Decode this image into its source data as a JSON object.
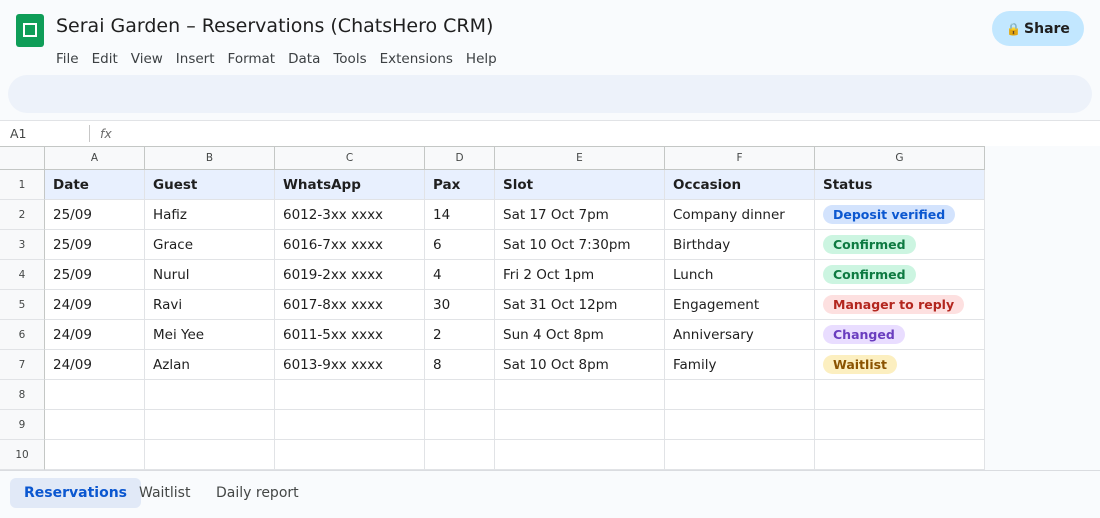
{
  "app": {
    "title": "Serai Garden – Reservations (ChatsHero CRM)",
    "share_label": "Share",
    "share_icon": "lock-icon"
  },
  "menu": [
    "File",
    "Edit",
    "View",
    "Insert",
    "Format",
    "Data",
    "Tools",
    "Extensions",
    "Help"
  ],
  "formula_bar": {
    "name_box": "A1",
    "fx_label": "fx",
    "value": ""
  },
  "sheet": {
    "columns": [
      "A",
      "B",
      "C",
      "D",
      "E",
      "F",
      "G"
    ],
    "row_numbers": [
      "1",
      "2",
      "3",
      "4",
      "5",
      "6",
      "7",
      "8",
      "9",
      "10"
    ],
    "headers": [
      "Date",
      "Guest",
      "WhatsApp",
      "Pax",
      "Slot",
      "Occasion",
      "Status"
    ],
    "rows": [
      {
        "date": "25/09",
        "guest": "Hafiz",
        "whatsapp": "6012-3xx xxxx",
        "pax": "14",
        "slot": "Sat 17 Oct 7pm",
        "occasion": "Company dinner",
        "status": "Deposit verified",
        "status_color": "blue"
      },
      {
        "date": "25/09",
        "guest": "Grace",
        "whatsapp": "6016-7xx xxxx",
        "pax": "6",
        "slot": "Sat 10 Oct 7:30pm",
        "occasion": "Birthday",
        "status": "Confirmed",
        "status_color": "green"
      },
      {
        "date": "25/09",
        "guest": "Nurul",
        "whatsapp": "6019-2xx xxxx",
        "pax": "4",
        "slot": "Fri 2 Oct 1pm",
        "occasion": "Lunch",
        "status": "Confirmed",
        "status_color": "green"
      },
      {
        "date": "24/09",
        "guest": "Ravi",
        "whatsapp": "6017-8xx xxxx",
        "pax": "30",
        "slot": "Sat 31 Oct 12pm",
        "occasion": "Engagement",
        "status": "Manager to reply",
        "status_color": "red"
      },
      {
        "date": "24/09",
        "guest": "Mei Yee",
        "whatsapp": "6011-5xx xxxx",
        "pax": "2",
        "slot": "Sun 4 Oct 8pm",
        "occasion": "Anniversary",
        "status": "Changed",
        "status_color": "purple"
      },
      {
        "date": "24/09",
        "guest": "Azlan",
        "whatsapp": "6013-9xx xxxx",
        "pax": "8",
        "slot": "Sat 10 Oct 8pm",
        "occasion": "Family",
        "status": "Waitlist",
        "status_color": "yellow"
      }
    ]
  },
  "tabs": [
    {
      "label": "Reservations",
      "active": true
    },
    {
      "label": "Waitlist",
      "active": false
    },
    {
      "label": "Daily report",
      "active": false
    }
  ],
  "colors": {
    "brand_green": "#0f9d58",
    "share_bg": "#c2e7ff",
    "header_row_bg": "#e8f0fe",
    "active_tab": "#0b57d0"
  }
}
